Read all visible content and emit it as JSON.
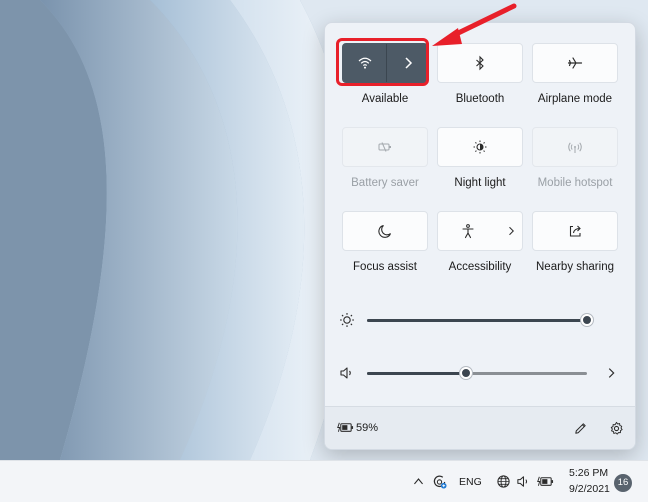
{
  "quick_settings": {
    "tiles": [
      {
        "id": "wifi",
        "label": "Available",
        "icon": "wifi-icon",
        "state": "on",
        "has_chevron": true
      },
      {
        "id": "bluetooth",
        "label": "Bluetooth",
        "icon": "bluetooth-icon",
        "state": "off"
      },
      {
        "id": "airplane",
        "label": "Airplane mode",
        "icon": "airplane-icon",
        "state": "off"
      },
      {
        "id": "battery_saver",
        "label": "Battery saver",
        "icon": "battery-saver-icon",
        "state": "disabled"
      },
      {
        "id": "night_light",
        "label": "Night light",
        "icon": "night-light-icon",
        "state": "off"
      },
      {
        "id": "mobile_hotspot",
        "label": "Mobile hotspot",
        "icon": "hotspot-icon",
        "state": "disabled"
      },
      {
        "id": "focus_assist",
        "label": "Focus assist",
        "icon": "moon-icon",
        "state": "off"
      },
      {
        "id": "accessibility",
        "label": "Accessibility",
        "icon": "accessibility-icon",
        "state": "off",
        "has_chevron": true
      },
      {
        "id": "nearby_sharing",
        "label": "Nearby sharing",
        "icon": "share-icon",
        "state": "off"
      }
    ],
    "brightness": {
      "icon": "brightness-icon",
      "level": 1.0
    },
    "volume": {
      "icon": "speaker-icon",
      "level": 0.45
    },
    "footer": {
      "battery_percent": "59%",
      "icon_battery": "battery-charging-icon",
      "icon_edit": "pencil-icon",
      "icon_settings": "gear-icon"
    }
  },
  "taskbar": {
    "language": "ENG",
    "time": "5:26 PM",
    "date": "9/2/2021",
    "notification_count": "16"
  },
  "colors": {
    "active_tile": "#4d5a66",
    "highlight": "#e8202a",
    "arrow": "#e8202a"
  }
}
